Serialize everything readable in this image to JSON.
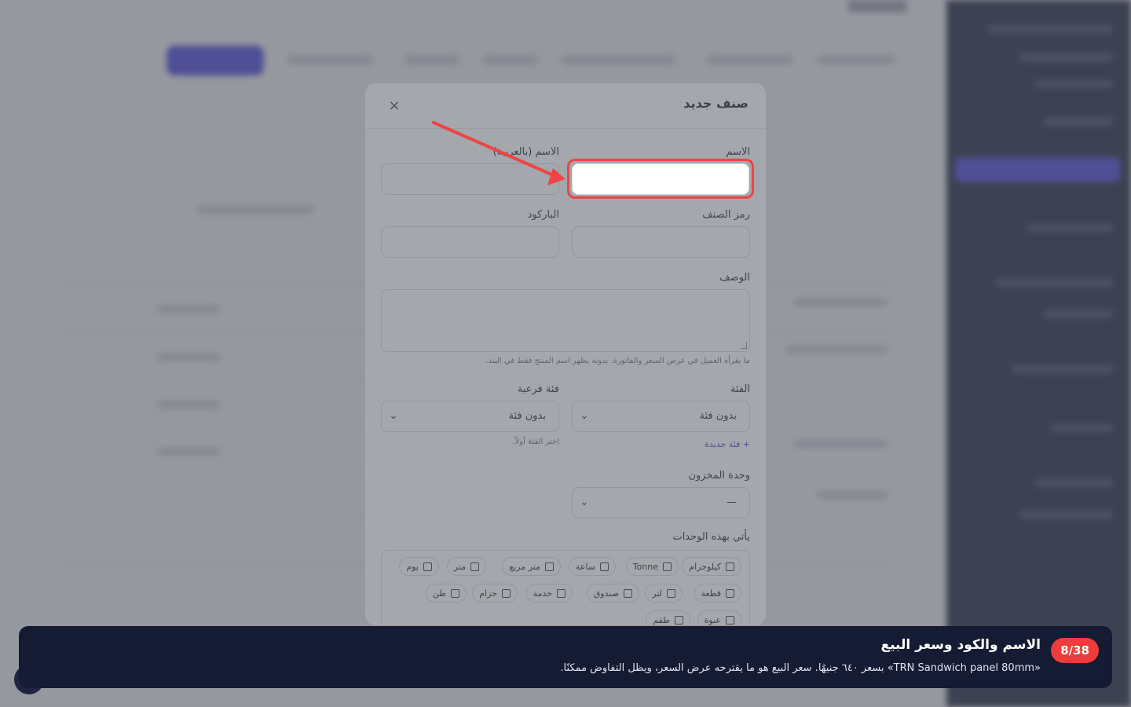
{
  "modal": {
    "title": "صنف جديد",
    "close": "×",
    "name_label": "الاسم",
    "name_value": "",
    "name_ar_label": "الاسم (بالعربية)",
    "name_ar_value": "",
    "sku_label": "رمز الصنف",
    "sku_value": "",
    "barcode_label": "الباركود",
    "barcode_value": "",
    "description_label": "الوصف",
    "description_hint": "ما يقرأه العميل في عرض السعر والفاتورة. بدونه يظهر اسم المنتج فقط في البند.",
    "category_label": "الفئة",
    "category_value": "بدون فئة",
    "new_category_link": "+ فئة جديدة",
    "subcategory_label": "فئة فرعية",
    "subcategory_value": "بدون فئة",
    "subcategory_hint": "اختر الفئة أولاً.",
    "stock_unit_label": "وحدة المخزون",
    "stock_unit_value": "—",
    "units_label": "يأتي بهذه الوحدات",
    "units_row1": [
      "كيلوجرام",
      "Tonne",
      "ساعة",
      "متر مربع",
      "متر",
      "يوم"
    ],
    "units_row2": [
      "قطعة",
      "لتر",
      "صندوق",
      "خدمة",
      "حزام",
      "طن"
    ],
    "units_row3": [
      "عبوة",
      "طقم"
    ]
  },
  "tour": {
    "step": "8/38",
    "title": "الاسم والكود وسعر البيع",
    "description": "«TRN Sandwich panel 80mm» بسعر ٦٤٠ جنيهًا. سعر البيع هو ما يقترحه عرض السعر، ويظل التفاوض ممكنًا."
  },
  "colors": {
    "accent": "#3f37e0",
    "highlight": "#ef4444",
    "banner": "#151b33",
    "badge": "#ef3b3b"
  }
}
